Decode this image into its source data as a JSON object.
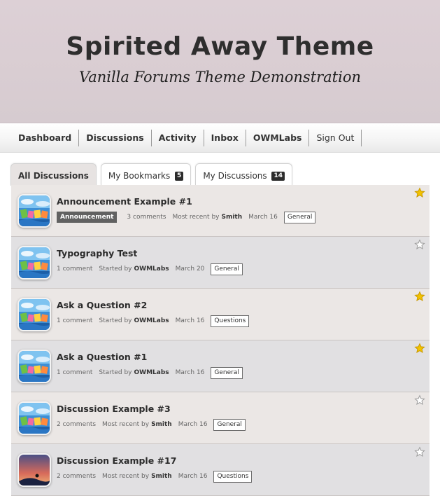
{
  "header": {
    "title": "Spirited Away Theme",
    "subtitle": "Vanilla Forums Theme Demonstration"
  },
  "menu": [
    {
      "label": "Dashboard"
    },
    {
      "label": "Discussions"
    },
    {
      "label": "Activity"
    },
    {
      "label": "Inbox"
    },
    {
      "label": "OWMLabs"
    },
    {
      "label": "Sign Out"
    }
  ],
  "tabs": {
    "all": {
      "label": "All Discussions"
    },
    "bookmarks": {
      "label": "My Bookmarks",
      "count": "5"
    },
    "mine": {
      "label": "My Discussions",
      "count": "14"
    }
  },
  "discussions": [
    {
      "title": "Announcement Example #1",
      "badge": "Announcement",
      "comments": "3 comments",
      "by_prefix": "Most recent by",
      "user": "Smith",
      "date": "March 16",
      "category": "General",
      "starred": true,
      "avatar": "landscape-icon"
    },
    {
      "title": "Typography Test",
      "comments": "1 comment",
      "by_prefix": "Started by",
      "user": "OWMLabs",
      "date": "March 20",
      "category": "General",
      "starred": false,
      "avatar": "landscape-icon"
    },
    {
      "title": "Ask a Question #2",
      "comments": "1 comment",
      "by_prefix": "Started by",
      "user": "OWMLabs",
      "date": "March 16",
      "category": "Questions",
      "starred": true,
      "avatar": "landscape-icon"
    },
    {
      "title": "Ask a Question #1",
      "comments": "1 comment",
      "by_prefix": "Started by",
      "user": "OWMLabs",
      "date": "March 16",
      "category": "General",
      "starred": true,
      "avatar": "landscape-icon"
    },
    {
      "title": "Discussion Example #3",
      "comments": "2 comments",
      "by_prefix": "Most recent by",
      "user": "Smith",
      "date": "March 16",
      "category": "General",
      "starred": false,
      "avatar": "landscape-icon"
    },
    {
      "title": "Discussion Example #17",
      "comments": "2 comments",
      "by_prefix": "Most recent by",
      "user": "Smith",
      "date": "March 16",
      "category": "Questions",
      "starred": false,
      "avatar": "sunset-icon"
    }
  ],
  "colors": {
    "banner": "#ddd0d6",
    "row": "#ebe7e5",
    "row_alt": "#e1e0e2",
    "star_on": "#f2c200",
    "star_off": "#ffffff"
  }
}
